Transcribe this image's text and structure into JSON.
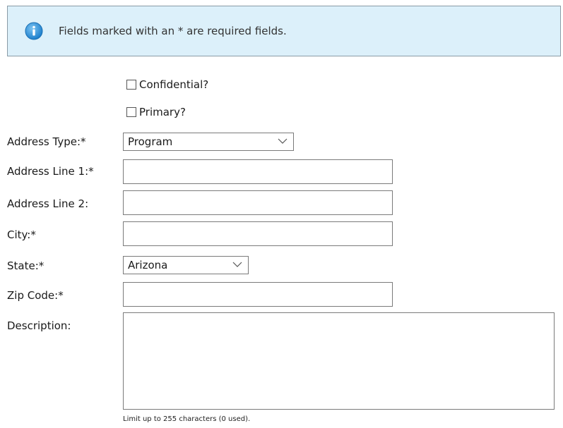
{
  "banner": {
    "icon": "info-icon",
    "text": "Fields marked with an * are required fields.",
    "background_color": "#dcf0fa",
    "icon_color": "#2a8fd6"
  },
  "form": {
    "confidential_label": "Confidential?",
    "confidential_checked": false,
    "primary_label": "Primary?",
    "primary_checked": false,
    "address_type_label": "Address Type:*",
    "address_type_value": "Program",
    "address_line1_label": "Address Line 1:*",
    "address_line1_value": "",
    "address_line2_label": "Address Line 2:",
    "address_line2_value": "",
    "city_label": "City:*",
    "city_value": "",
    "state_label": "State:*",
    "state_value": "Arizona",
    "zip_label": "Zip Code:*",
    "zip_value": "",
    "description_label": "Description:",
    "description_value": "",
    "limit_note": "Limit up to 255 characters (0 used)."
  }
}
